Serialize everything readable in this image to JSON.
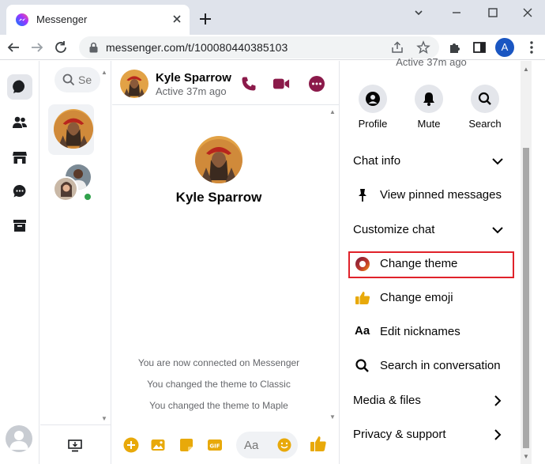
{
  "browser": {
    "tab_title": "Messenger",
    "url": "messenger.com/t/100080440385103",
    "profile_initial": "A"
  },
  "search": {
    "placeholder": "Se"
  },
  "conversation": {
    "contact_name": "Kyle Sparrow",
    "contact_status": "Active 37m ago",
    "profile_name": "Kyle Sparrow",
    "system_messages": [
      "You are now connected on Messenger",
      "You changed the theme to Classic",
      "You changed the theme to Maple"
    ],
    "composer_placeholder": "Aa"
  },
  "info_panel": {
    "cut_status": "Active 37m ago",
    "actions": [
      "Profile",
      "Mute",
      "Search"
    ],
    "chat_info": "Chat info",
    "view_pinned": "View pinned messages",
    "customize_chat": "Customize chat",
    "change_theme": "Change theme",
    "change_emoji": "Change emoji",
    "edit_nicknames": "Edit nicknames",
    "search_conversation": "Search in conversation",
    "media_files": "Media & files",
    "privacy_support": "Privacy & support",
    "nickname_icon_text": "Aa"
  },
  "colors": {
    "accent": "#8b1a4a",
    "rail_icon": "#1c1e21",
    "highlight": "#e0222a",
    "online": "#31a24c"
  }
}
